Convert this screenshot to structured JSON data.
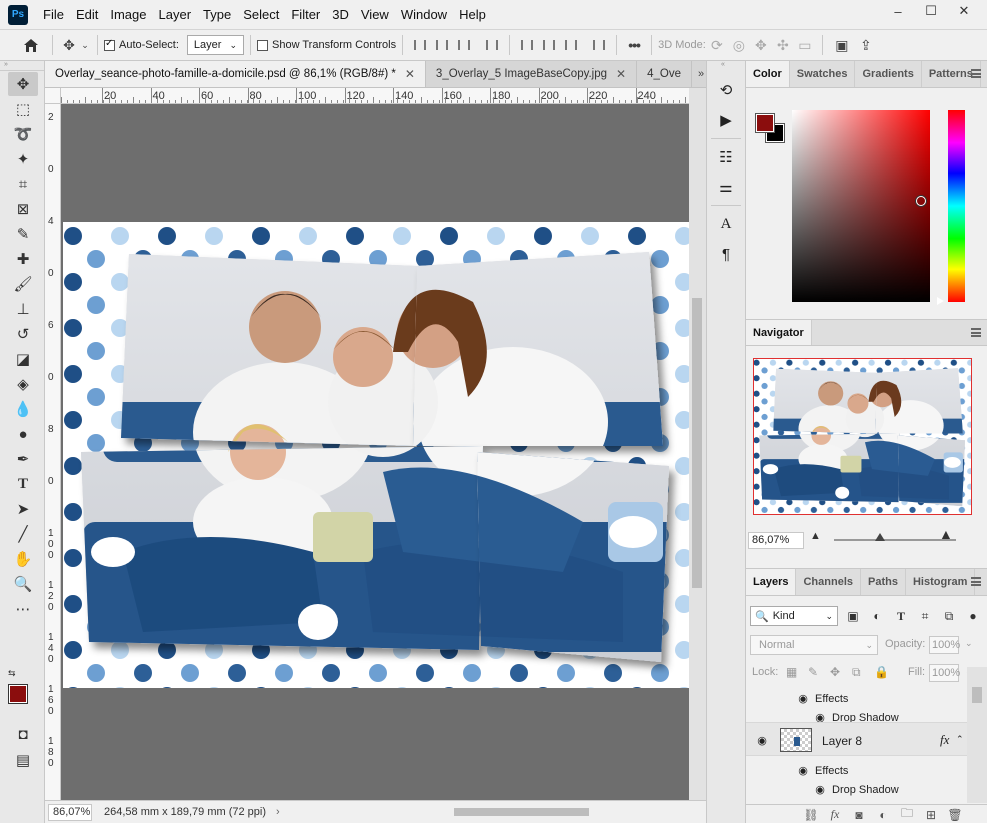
{
  "menubar": {
    "app_logo": "Ps",
    "items": [
      "File",
      "Edit",
      "Image",
      "Layer",
      "Type",
      "Select",
      "Filter",
      "3D",
      "View",
      "Window",
      "Help"
    ],
    "window_controls": [
      "–",
      "☐",
      "✕"
    ]
  },
  "options": {
    "auto_select_label": "Auto-Select:",
    "auto_select_checked": true,
    "target": "Layer",
    "transform_label": "Show Transform Controls",
    "transform_checked": false,
    "more": "•••",
    "mode_3d_label": "3D Mode:"
  },
  "tools": [
    "move-tool",
    "marquee-tool",
    "lasso-tool",
    "magic-wand-tool",
    "crop-tool",
    "frame-tool",
    "eyedropper-tool",
    "healing-brush-tool",
    "brush-tool",
    "clone-stamp-tool",
    "history-brush-tool",
    "eraser-tool",
    "paint-bucket-tool",
    "blur-tool",
    "dodge-tool",
    "pen-tool",
    "type-tool",
    "path-selection-tool",
    "line-tool",
    "hand-tool",
    "zoom-tool",
    "more-tools"
  ],
  "colors": {
    "foreground": "#8b0d0d",
    "background": "#000000",
    "canvas_bg": "#6e6e6e",
    "accent_blue": "#2a5a8f"
  },
  "tabs": [
    {
      "label": "Overlay_seance-photo-famille-a-domicile.psd @ 86,1% (RGB/8#) *",
      "close": "✕",
      "active": true
    },
    {
      "label": "3_Overlay_5 ImageBaseCopy.jpg",
      "close": "✕",
      "active": false
    },
    {
      "label": "4_Ove",
      "close": "",
      "active": false
    }
  ],
  "ruler": {
    "top_labels": [
      "20",
      "40",
      "60",
      "80",
      "100",
      "120",
      "140",
      "160",
      "180",
      "200",
      "220",
      "240"
    ],
    "left_labels": [
      "2",
      "0",
      "4",
      "0",
      "6",
      "0",
      "8",
      "0",
      "1\n0\n0",
      "1\n2\n0",
      "1\n4\n0",
      "1\n6\n0",
      "1\n8\n0"
    ]
  },
  "status": {
    "zoom": "86,07%",
    "dimensions": "264,58 mm x 189,79 mm (72 ppi)"
  },
  "color_panel": {
    "tabs": [
      "Color",
      "Swatches",
      "Gradients",
      "Patterns"
    ]
  },
  "navigator": {
    "title": "Navigator",
    "zoom": "86,07%"
  },
  "layers": {
    "tabs": [
      "Layers",
      "Channels",
      "Paths",
      "Histogram"
    ],
    "kind": "Kind",
    "blend_mode": "Normal",
    "opacity_label": "Opacity:",
    "opacity": "100%",
    "lock_label": "Lock:",
    "fill_label": "Fill:",
    "fill": "100%",
    "rows": [
      {
        "type": "effects",
        "label": "Effects"
      },
      {
        "type": "effect",
        "label": "Drop Shadow"
      },
      {
        "type": "layer",
        "label": "Layer 8",
        "fx": "fx"
      },
      {
        "type": "effects",
        "label": "Effects"
      },
      {
        "type": "effect",
        "label": "Drop Shadow"
      }
    ]
  }
}
